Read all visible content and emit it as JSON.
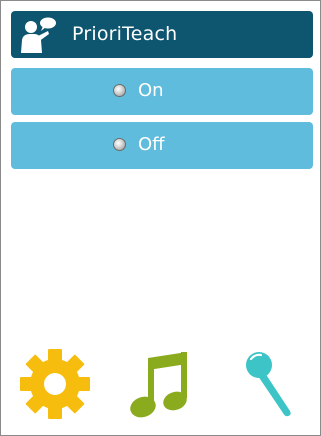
{
  "app": {
    "title": "PrioriTeach",
    "icon": "teacher-speech-bubble-icon"
  },
  "options": [
    {
      "label": "On",
      "selected": false
    },
    {
      "label": "Off",
      "selected": false
    }
  ],
  "bottom_bar": {
    "icons": [
      "settings-gear-icon",
      "music-note-icon",
      "microphone-icon"
    ]
  },
  "colors": {
    "titlebar": "#0e5570",
    "option_bg": "#5fbcdd",
    "gear": "#f6bd0f",
    "music": "#8bab1f",
    "mic": "#3cc4c7"
  }
}
